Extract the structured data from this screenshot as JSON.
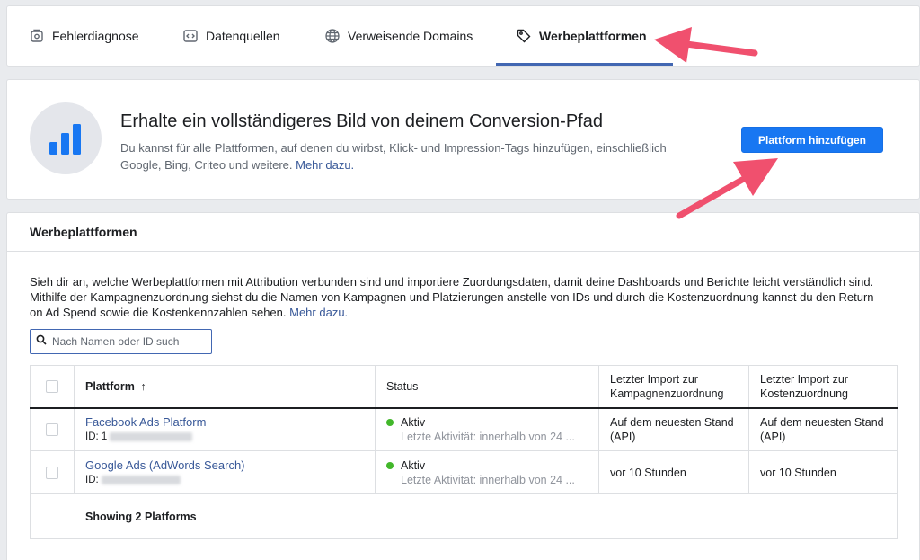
{
  "tabs": [
    {
      "label": "Fehlerdiagnose",
      "icon": "wrench-badge-icon"
    },
    {
      "label": "Datenquellen",
      "icon": "code-icon"
    },
    {
      "label": "Verweisende Domains",
      "icon": "globe-icon"
    },
    {
      "label": "Werbeplattformen",
      "icon": "tag-icon",
      "active": true
    }
  ],
  "promo": {
    "title": "Erhalte ein vollständigeres Bild von deinem Conversion-Pfad",
    "text": "Du kannst für alle Plattformen, auf denen du wirbst, Klick- und Impression-Tags hinzufügen, einschließlich Google, Bing, Criteo und weitere.",
    "link": "Mehr dazu.",
    "button": "Plattform hinzufügen"
  },
  "main": {
    "title": "Werbeplattformen",
    "description": "Sieh dir an, welche Werbeplattformen mit Attribution verbunden sind und importiere Zuordungsdaten, damit deine Dashboards und Berichte leicht verständlich sind. Mithilfe der Kampagnenzuordnung siehst du die Namen von Kampagnen und Platzierungen anstelle von IDs und durch die Kostenzuordnung kannst du den Return on Ad Spend sowie die Kostenkennzahlen sehen.",
    "description_link": "Mehr dazu.",
    "search_placeholder": "Nach Namen oder ID such"
  },
  "table": {
    "headers": {
      "platform": "Plattform",
      "sort_arrow": "↑",
      "status": "Status",
      "campaign_import": "Letzter Import zur Kampagnenzuordnung",
      "cost_import": "Letzter Import zur Kostenzuordnung"
    },
    "rows": [
      {
        "name": "Facebook Ads Platform",
        "id_prefix": "ID: 1",
        "status": "Aktiv",
        "status_sub": "Letzte Aktivität: innerhalb von 24 ...",
        "campaign_import": "Auf dem neuesten Stand (API)",
        "cost_import": "Auf dem neuesten Stand (API)"
      },
      {
        "name": "Google Ads (AdWords Search)",
        "id_prefix": "ID: ",
        "status": "Aktiv",
        "status_sub": "Letzte Aktivität: innerhalb von 24 ...",
        "campaign_import": "vor 10 Stunden",
        "cost_import": "vor 10 Stunden"
      }
    ],
    "footer": "Showing 2 Platforms"
  },
  "colors": {
    "accent": "#4267b2",
    "button": "#1877f2",
    "status_active": "#42b72a",
    "annotation_arrow": "#f0506e"
  }
}
